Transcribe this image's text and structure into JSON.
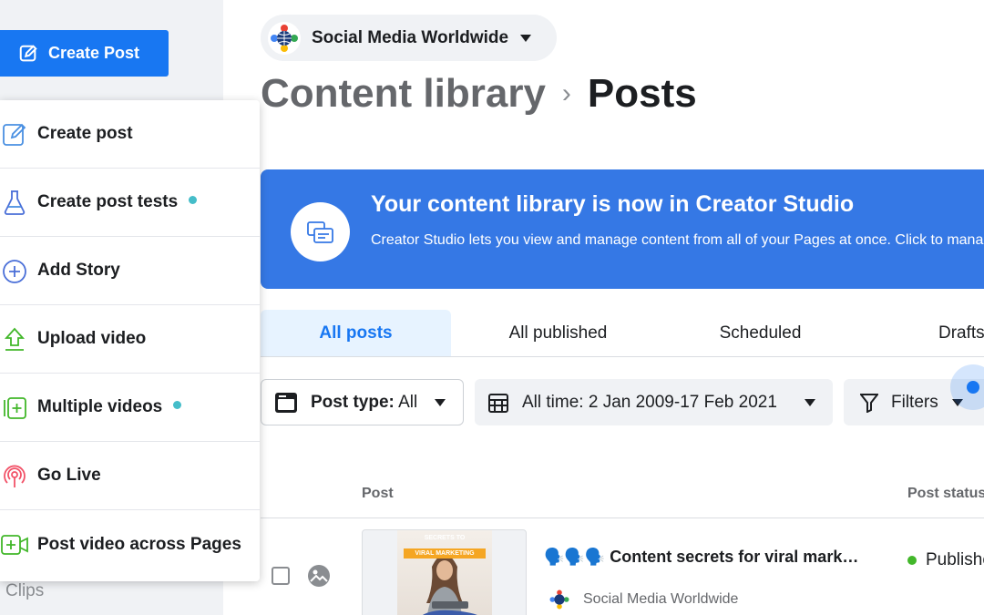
{
  "sidebar": {
    "create_button": "Create Post",
    "clips_label": "Clips"
  },
  "menu": {
    "items": [
      {
        "label": "Create post",
        "icon": "edit-icon",
        "new": false
      },
      {
        "label": "Create post tests",
        "icon": "flask-icon",
        "new": true
      },
      {
        "label": "Add Story",
        "icon": "plus-circle-icon",
        "new": false
      },
      {
        "label": "Upload video",
        "icon": "upload-icon",
        "new": false
      },
      {
        "label": "Multiple videos",
        "icon": "multi-video-icon",
        "new": true
      },
      {
        "label": "Go Live",
        "icon": "live-icon",
        "new": false
      },
      {
        "label": "Post video across Pages",
        "icon": "video-plus-icon",
        "new": false
      }
    ]
  },
  "header": {
    "page_name": "Social Media Worldwide",
    "breadcrumb_parent": "Content library",
    "breadcrumb_current": "Posts"
  },
  "banner": {
    "title": "Your content library is now in Creator Studio",
    "description": "Creator Studio lets you view and manage content from all of your Pages at once. Click to manage."
  },
  "tabs": [
    "All posts",
    "All published",
    "Scheduled",
    "Drafts"
  ],
  "filters": {
    "post_type_label": "Post type:",
    "post_type_value": "All",
    "date_range": "All time: 2 Jan 2009-17 Feb 2021",
    "filters_label": "Filters"
  },
  "table": {
    "columns": [
      "Post",
      "Post status"
    ],
    "rows": [
      {
        "title": "🗣️🗣️🗣️ Content secrets for viral mark…",
        "page": "Social Media Worldwide",
        "status": "Published",
        "thumb_text": "SECRETS TO",
        "thumb_badge": "VIRAL MARKETING"
      }
    ]
  },
  "colors": {
    "primary": "#1877f2",
    "banner": "#3578e5",
    "new_dot": "#45bdc9",
    "published": "#42b72a"
  }
}
